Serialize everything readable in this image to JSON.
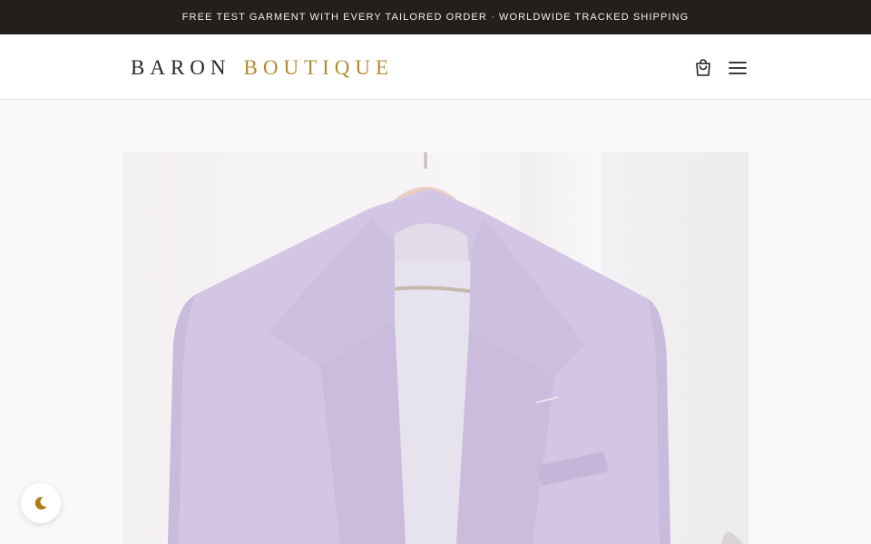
{
  "announcement": {
    "text": "FREE TEST GARMENT WITH EVERY TAILORED ORDER · WORLDWIDE TRACKED SHIPPING"
  },
  "brand": {
    "word1": "BARON",
    "word2": "BOUTIQUE",
    "accent_color": "#b48b32",
    "dark_color": "#2a2522"
  },
  "header": {
    "icons": [
      "shopping-bag-icon",
      "hamburger-menu-icon"
    ]
  },
  "hero": {
    "image": "lavender-double-breasted-jacket-on-wooden-hanger"
  },
  "theme_toggle": {
    "icon": "moon-icon"
  }
}
